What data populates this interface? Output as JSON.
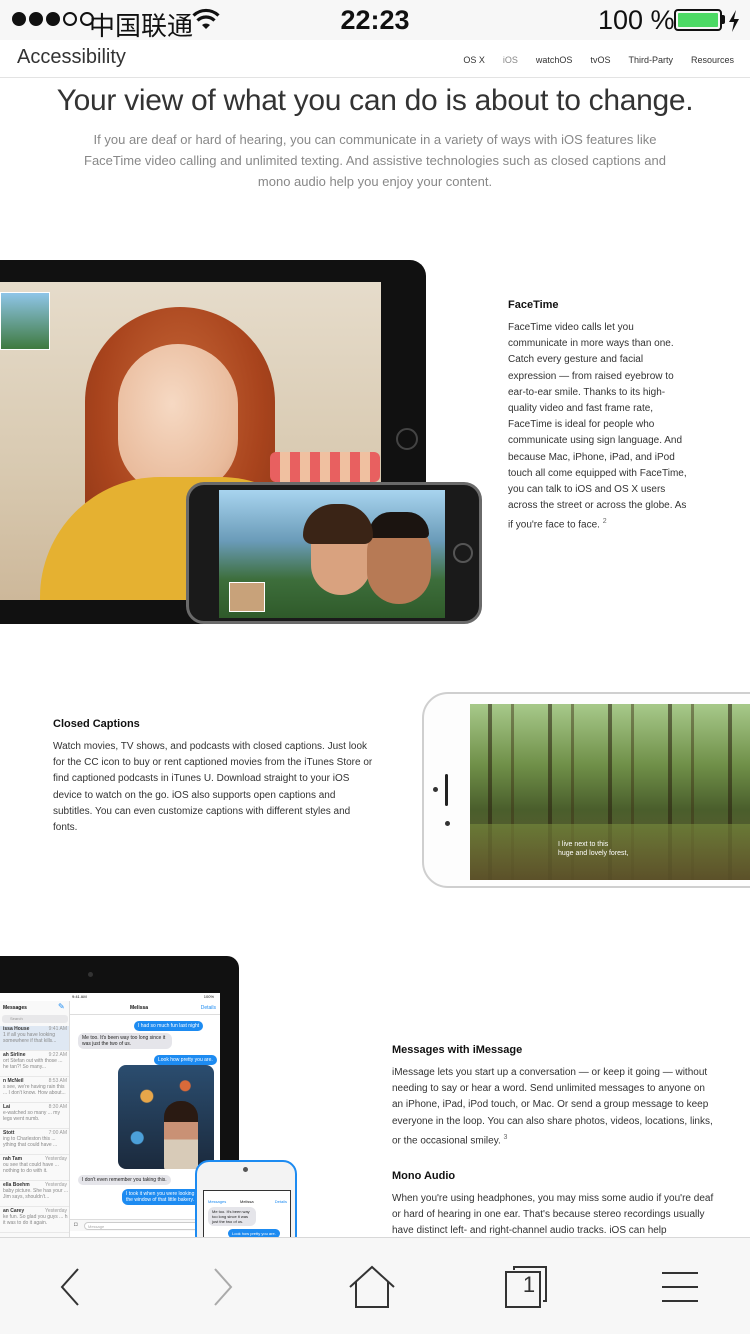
{
  "status_bar": {
    "carrier": "中国联通",
    "time": "22:23",
    "battery_percent": "100 %",
    "battery_level": 1.0,
    "signal_bars_filled": 3,
    "signal_bars_total": 5,
    "battery_color": "#4cd964"
  },
  "local_nav": {
    "title": "Accessibility",
    "links": [
      "OS X",
      "iOS",
      "watchOS",
      "tvOS",
      "Third-Party",
      "Resources"
    ],
    "active_index": 1
  },
  "hero": {
    "title": "Your view of what you can do is about to change.",
    "subtitle": "If you are deaf or hard of hearing, you can communicate in a variety of ways with iOS features like FaceTime video calling and unlimited texting. And assistive technologies such as closed captions and mono audio help you enjoy your content."
  },
  "facetime": {
    "heading": "FaceTime",
    "body": "FaceTime video calls let you communicate in more ways than one. Catch every gesture and facial expression — from raised eyebrow to ear-to-ear smile. Thanks to its high-quality video and fast frame rate, FaceTime is ideal for people who communicate using sign language. And because Mac, iPhone, iPad, and iPod touch all come equipped with FaceTime, you can talk to iOS and OS X users across the street or across the globe. As if you're face to face.",
    "footnote": "2"
  },
  "closed_captions": {
    "heading": "Closed Captions",
    "body": "Watch movies, TV shows, and podcasts with closed captions. Just look for the CC icon to buy or rent captioned movies from the iTunes Store or find captioned podcasts in iTunes U. Download straight to your iOS device to watch on the go. iOS also supports open captions and subtitles. You can even customize captions with different styles and fonts.",
    "caption_line1": "I live next to this",
    "caption_line2": "huge and lovely forest,"
  },
  "imessage": {
    "heading": "Messages with iMessage",
    "body": "iMessage lets you start up a conversation — or keep it going — without needing to say or hear a word. Send unlimited messages to anyone on an iPhone, iPad, iPod touch, or Mac. Or send a group message to keep everyone in the loop. You can also share photos, videos, locations, links, or the occasional smiley.",
    "footnote": "3",
    "screen": {
      "time": "9:41 AM",
      "battery": "100%",
      "messages_title": "Messages",
      "search_placeholder": "Search",
      "contact": "Melissa",
      "details": "Details",
      "list": [
        {
          "name": "issa House",
          "time": "9:41 AM",
          "preview": "1 if all you have looking somewhere if that kills..."
        },
        {
          "name": "ah Sirline",
          "time": "9:22 AM",
          "preview": "ort Stefan out with those ... he tan?! So many..."
        },
        {
          "name": "n McNeil",
          "time": "8:53 AM",
          "preview": "s see, we're having rain this ... I don't know. How about..."
        },
        {
          "name": "Lai",
          "time": "8:30 AM",
          "preview": "e-watched so many ... my legs went numb."
        },
        {
          "name": "Stott",
          "time": "7:00 AM",
          "preview": "ing to Charleston this ... ything that could have ..."
        },
        {
          "name": "rah Tam",
          "time": "Yesterday",
          "preview": "ou see that could have ... nothing to do with it."
        },
        {
          "name": "ella Boehm",
          "time": "Yesterday",
          "preview": "baby picture. She has your ... Jim says, shouldn't..."
        },
        {
          "name": "an Carey",
          "time": "Yesterday",
          "preview": "ke fun. So glad you guys ... h it was to do it again."
        }
      ],
      "bubbles": [
        {
          "dir": "out",
          "text": "I had so much fun last night"
        },
        {
          "dir": "in",
          "text": "Me too. It's been way too long since it was just the two of us."
        },
        {
          "dir": "out",
          "text": "Look how pretty you are."
        },
        {
          "dir": "in",
          "text": "I don't even remember you taking this."
        },
        {
          "dir": "out",
          "text": "I took it when you were looking out the window of that little bakery."
        }
      ],
      "compose_placeholder": "Message",
      "small_back": "Messages",
      "small_bubble_in": "Me too. It's been way too long since it was just the two of us.",
      "small_bubble_out": "Look how pretty you are."
    }
  },
  "mono_audio": {
    "heading": "Mono Audio",
    "body": "When you're using headphones, you may miss some audio if you're deaf or hard of hearing in one ear. That's because stereo recordings usually have distinct left- and right-channel audio tracks. iOS can help"
  },
  "toolbar": {
    "tab_count": "1",
    "icons": [
      "back-icon",
      "forward-icon",
      "home-icon",
      "tabs-icon",
      "menu-icon"
    ]
  }
}
